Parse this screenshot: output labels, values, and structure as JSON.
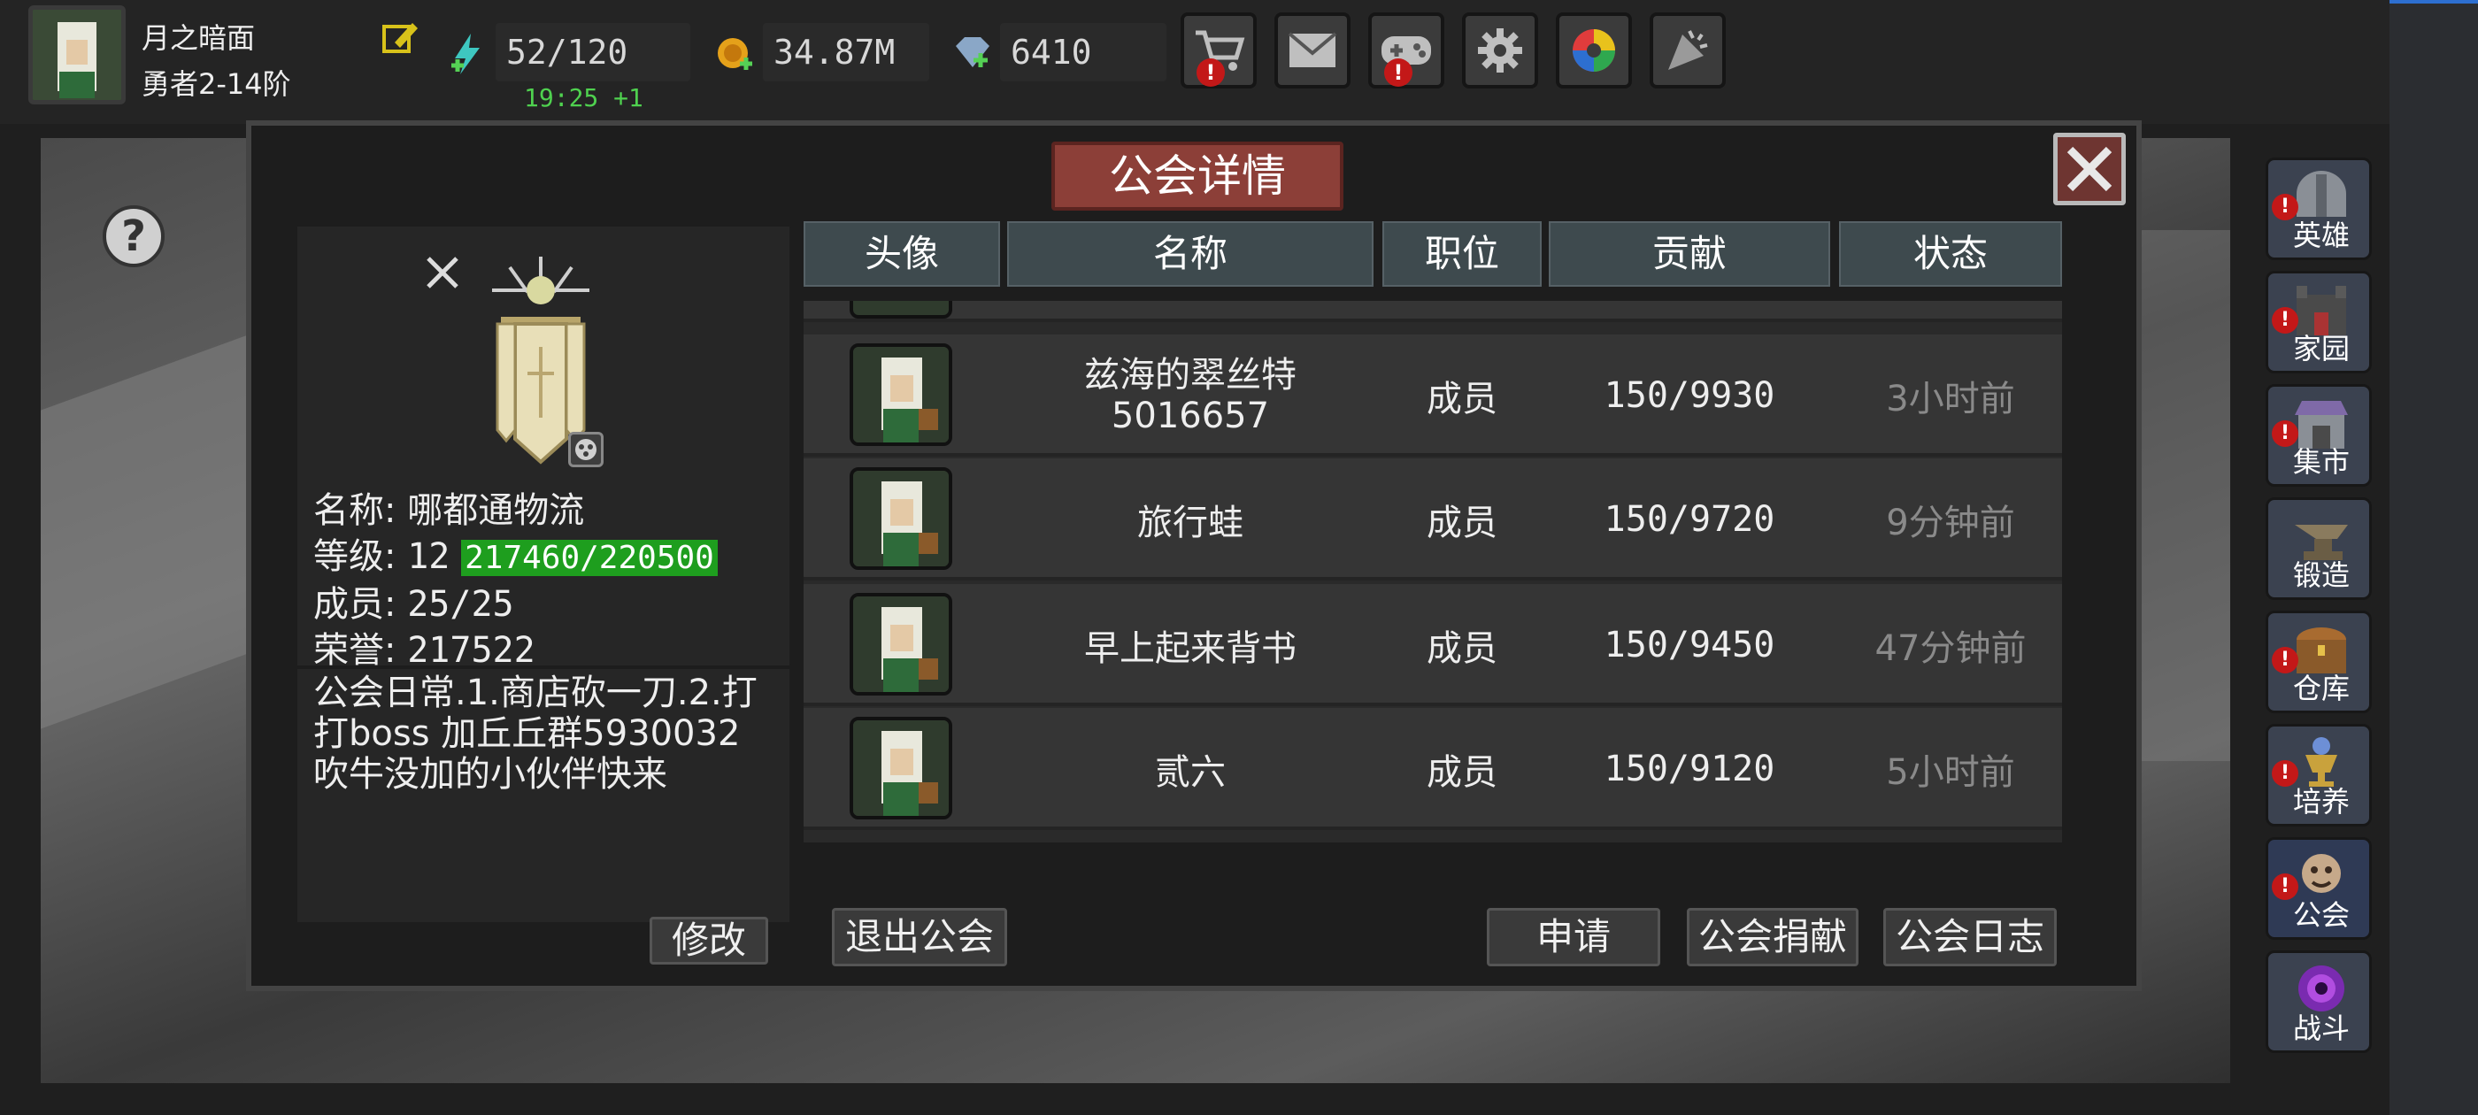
{
  "player": {
    "name": "月之暗面",
    "rank": "勇者2-14阶",
    "energy": "52/120",
    "energy_timer": "19:25 +1",
    "gold": "34.87M",
    "gems": "6410"
  },
  "dialog": {
    "title": "公会详情"
  },
  "guild": {
    "name_label": "名称:",
    "name": "哪都通物流",
    "level_label": "等级:",
    "level": "12",
    "exp": "217460/220500",
    "members_label": "成员:",
    "members": "25/25",
    "honor_label": "荣誉:",
    "honor": "217522",
    "description": "公会日常.1.商店砍一刀.2.打打boss   加丘丘群5930032 吹牛没加的小伙伴快来",
    "edit_button": "修改"
  },
  "table": {
    "columns": [
      "头像",
      "名称",
      "职位",
      "贡献",
      "状态"
    ],
    "rows": [
      {
        "name": "兹海的翠丝特\n5016657",
        "position": "成员",
        "contribution": "150/9930",
        "status": "3小时前"
      },
      {
        "name": "旅行蛙",
        "position": "成员",
        "contribution": "150/9720",
        "status": "9分钟前"
      },
      {
        "name": "早上起来背书",
        "position": "成员",
        "contribution": "150/9450",
        "status": "47分钟前"
      },
      {
        "name": "贰六",
        "position": "成员",
        "contribution": "150/9120",
        "status": "5小时前"
      }
    ]
  },
  "buttons": {
    "leave": "退出公会",
    "apply": "申请",
    "donate": "公会捐献",
    "log": "公会日志"
  },
  "sidebar": [
    {
      "label": "英雄",
      "icon": "helmet-icon",
      "badge": "!"
    },
    {
      "label": "家园",
      "icon": "castle-icon",
      "badge": "!"
    },
    {
      "label": "集市",
      "icon": "shop-icon",
      "badge": "!"
    },
    {
      "label": "锻造",
      "icon": "anvil-icon",
      "badge": ""
    },
    {
      "label": "仓库",
      "icon": "chest-icon",
      "badge": "!"
    },
    {
      "label": "培养",
      "icon": "chalice-icon",
      "badge": "!"
    },
    {
      "label": "公会",
      "icon": "guild-icon",
      "badge": "!"
    },
    {
      "label": "战斗",
      "icon": "portal-icon",
      "badge": ""
    }
  ],
  "colors": {
    "exp_bar": "#1e9e1e",
    "timer_green": "#4fd14f",
    "status_grey": "#8a8a8a",
    "badge_red": "#c31818"
  }
}
